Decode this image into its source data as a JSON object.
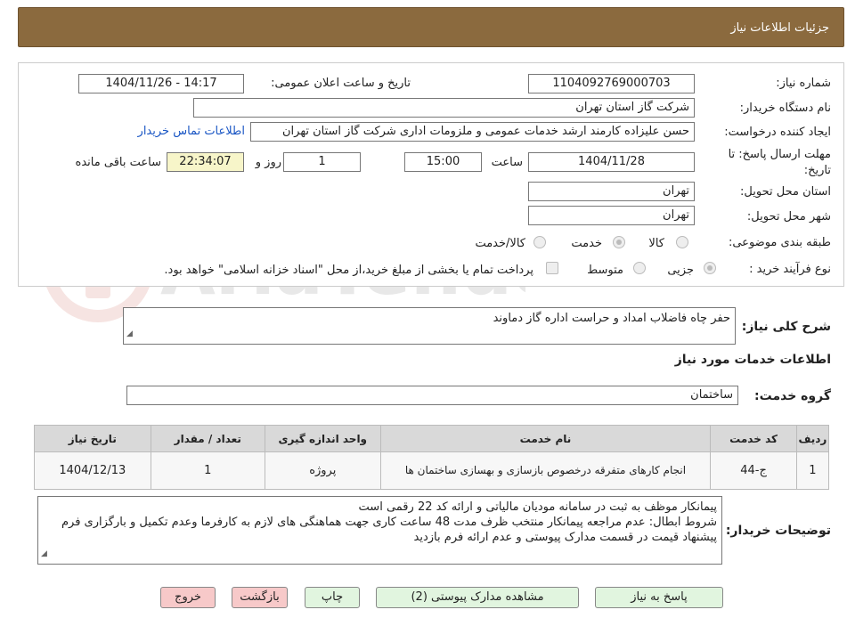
{
  "header": {
    "title": "جزئیات اطلاعات نیاز"
  },
  "fields": {
    "need_number_label": "شماره نیاز:",
    "need_number": "1104092769000703",
    "announce_label": "تاریخ و ساعت اعلان عمومی:",
    "announce_value": "1404/11/26 - 14:17",
    "buyer_org_label": "نام دستگاه خریدار:",
    "buyer_org": "شرکت گاز استان تهران",
    "creator_label": "ایجاد کننده درخواست:",
    "creator": "حسن علیزاده کارمند ارشد خدمات عمومی و ملزومات اداری شرکت گاز استان تهران",
    "contact_link": "اطلاعات تماس خریدار",
    "deadline_label_1": "مهلت ارسال پاسخ: تا",
    "deadline_label_2": "تاریخ:",
    "deadline_date": "1404/11/28",
    "time_label": "ساعت",
    "deadline_time": "15:00",
    "days_value": "1",
    "days_label": "روز و",
    "remaining_time": "22:34:07",
    "remaining_label": "ساعت باقی مانده",
    "province_label": "استان محل تحویل:",
    "province": "تهران",
    "city_label": "شهر محل تحویل:",
    "city": "تهران",
    "category_label": "طبقه بندی موضوعی:",
    "category_options": [
      "کالا",
      "خدمت",
      "کالا/خدمت"
    ],
    "process_label": "نوع فرآیند خرید :",
    "process_options": [
      "جزیی",
      "متوسط"
    ],
    "payment_note": "پرداخت تمام یا بخشی از مبلغ خرید،از محل \"اسناد خزانه اسلامی\" خواهد بود."
  },
  "summary": {
    "label": "شرح کلی نیاز:",
    "value": "حفر چاه فاضلاب امداد و حراست اداره گاز دماوند"
  },
  "services": {
    "section_title": "اطلاعات خدمات مورد نیاز",
    "group_label": "گروه خدمت:",
    "group_value": "ساختمان",
    "columns": [
      "ردیف",
      "کد خدمت",
      "نام خدمت",
      "واحد اندازه گیری",
      "تعداد / مقدار",
      "تاریخ نیاز"
    ],
    "rows": [
      [
        "1",
        "ج-44",
        "انجام کارهای متفرقه درخصوص بازسازی و بهسازی ساختمان ها",
        "پروژه",
        "1",
        "1404/12/13"
      ]
    ]
  },
  "notes": {
    "label": "توضیحات خریدار:",
    "line1": "پیمانکار موظف به ثبت در سامانه مودیان مالیاتی و ارائه کد 22 رقمی است",
    "line2": "شروط ابطال: عدم مراجعه پیمانکار منتخب ظرف مدت 48 ساعت کاری جهت هماهنگی های لازم به کارفرما وعدم تکمیل و بارگزاری فرم پیشنهاد قیمت در قسمت مدارک پیوستی و عدم ارائه فرم بازدید"
  },
  "buttons": {
    "reply": "پاسخ به نیاز",
    "attachments": "مشاهده مدارک پیوستی (2)",
    "print": "چاپ",
    "back": "بازگشت",
    "exit": "خروج"
  },
  "watermark": {
    "text": "AriaTender.neT"
  },
  "colors": {
    "header_bg": "#8b6a3e",
    "table_header_bg": "#d9d9d9",
    "green_button": "#e1f5df",
    "red_button": "#f7c9c9"
  }
}
